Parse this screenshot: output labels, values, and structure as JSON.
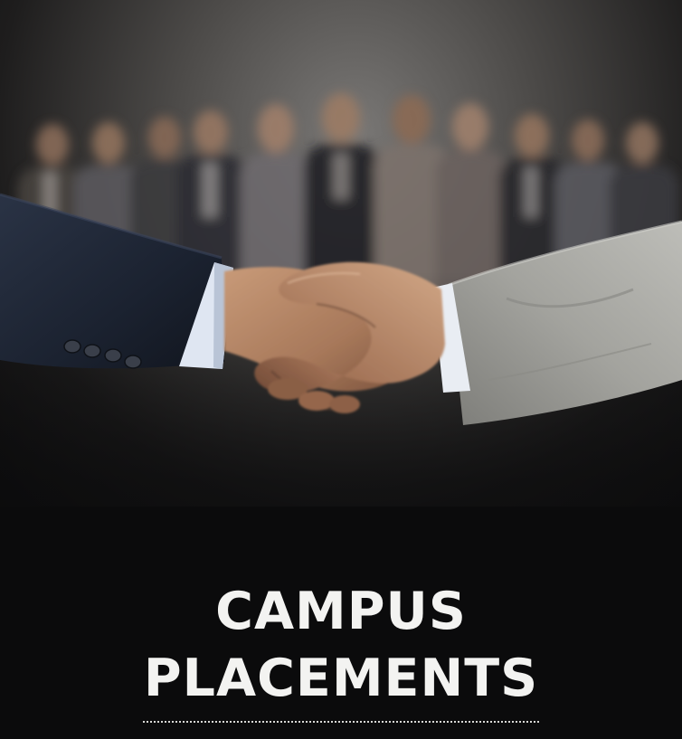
{
  "title": {
    "line1": "CAMPUS",
    "line2": "PLACEMENTS"
  },
  "scene": {
    "subject": "handshake",
    "background_group_count": 12
  },
  "colors": {
    "background": "#0b0b0c",
    "title_text": "#f3f3f1",
    "suit_dark": "#1b2230",
    "suit_grey": "#a3a39e",
    "shirt_cuff": "#dfe6f2"
  }
}
